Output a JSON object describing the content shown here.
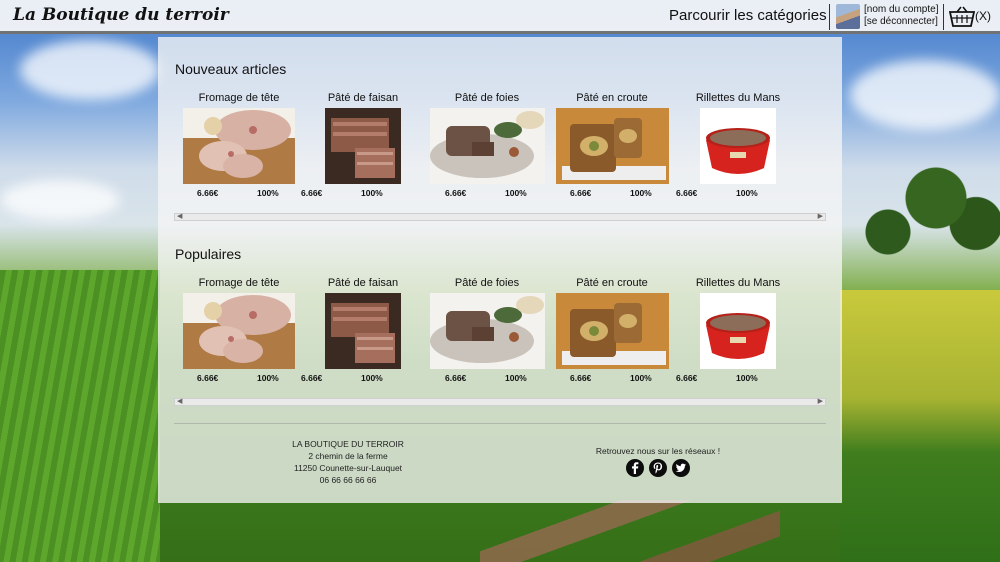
{
  "header": {
    "brand": "La Boutique du terroir",
    "browse_label": "Parcourir les catégories",
    "account_name": "[nom du compte]",
    "logout_label": "[se déconnecter]",
    "cart_count": "(X)"
  },
  "sections": [
    {
      "title": "Nouveaux articles",
      "products": [
        {
          "name": "Fromage de tête",
          "price": "6.66€",
          "rating": "100%",
          "image": "fromage-de-tete"
        },
        {
          "name": "Pâté de faisan",
          "price": "6.66€",
          "rating": "100%",
          "image": "pate-de-faisan"
        },
        {
          "name": "Pâté de foies",
          "price": "6.66€",
          "rating": "100%",
          "image": "pate-de-foies"
        },
        {
          "name": "Pâté en croute",
          "price": "6.66€",
          "rating": "100%",
          "image": "pate-en-croute"
        },
        {
          "name": "Rillettes du Mans",
          "price": "6.66€",
          "rating": "100%",
          "image": "rillettes-du-mans"
        }
      ]
    },
    {
      "title": "Populaires",
      "products": [
        {
          "name": "Fromage de tête",
          "price": "6.66€",
          "rating": "100%",
          "image": "fromage-de-tete"
        },
        {
          "name": "Pâté de faisan",
          "price": "6.66€",
          "rating": "100%",
          "image": "pate-de-faisan"
        },
        {
          "name": "Pâté de foies",
          "price": "6.66€",
          "rating": "100%",
          "image": "pate-de-foies"
        },
        {
          "name": "Pâté en croute",
          "price": "6.66€",
          "rating": "100%",
          "image": "pate-en-croute"
        },
        {
          "name": "Rillettes du Mans",
          "price": "6.66€",
          "rating": "100%",
          "image": "rillettes-du-mans"
        }
      ]
    }
  ],
  "footer": {
    "address_lines": [
      "LA BOUTIQUE DU TERROIR",
      "2 chemin de la ferme",
      "11250 Counette-sur-Lauquet",
      "06 66 66 66 66"
    ],
    "social_text": "Retrouvez nous sur les réseaux !",
    "social_icons": [
      "facebook-icon",
      "pinterest-icon",
      "twitter-icon"
    ]
  },
  "colors": {
    "topbar_bg": "#f8f8f8",
    "text": "#111111",
    "icon_bg": "#0c0c0c"
  }
}
